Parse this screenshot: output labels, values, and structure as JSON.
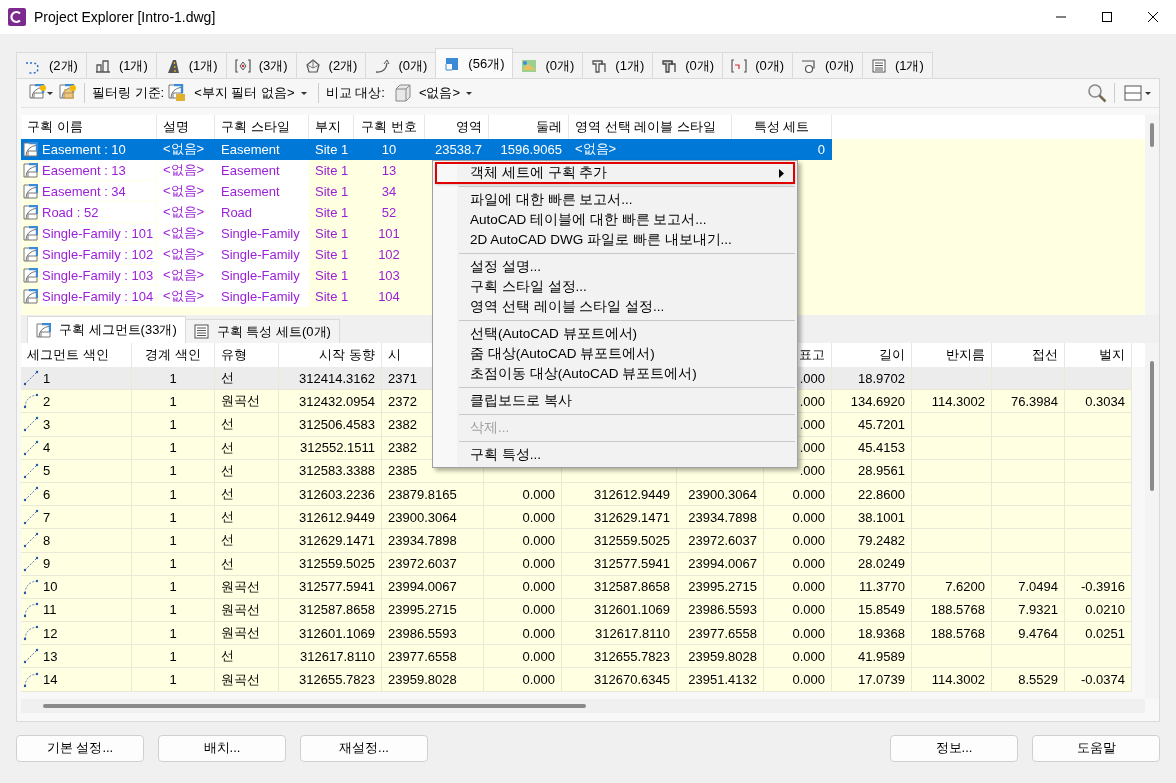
{
  "window": {
    "title": "Project Explorer [Intro-1.dwg]"
  },
  "tabs": [
    {
      "label": "(2개)",
      "selected": false
    },
    {
      "label": "(1개)",
      "selected": false
    },
    {
      "label": "(1개)",
      "selected": false
    },
    {
      "label": "(3개)",
      "selected": false
    },
    {
      "label": "(2개)",
      "selected": false
    },
    {
      "label": "(0개)",
      "selected": false
    },
    {
      "label": "(56개)",
      "selected": true
    },
    {
      "label": "(0개)",
      "selected": false
    },
    {
      "label": "(1개)",
      "selected": false
    },
    {
      "label": "(0개)",
      "selected": false
    },
    {
      "label": "(0개)",
      "selected": false
    },
    {
      "label": "(0개)",
      "selected": false
    },
    {
      "label": "(1개)",
      "selected": false
    }
  ],
  "toolbar": {
    "filter_label": "필터링 기준:",
    "filter_value": "<부지 필터 없음>",
    "compare_label": "비교 대상:",
    "compare_value": "<없음>"
  },
  "parcels": {
    "columns": [
      "구획 이름",
      "설명",
      "구획 스타일",
      "부지",
      "구획 번호",
      "영역",
      "둘레",
      "영역 선택 레이블 스타일",
      "특성 세트"
    ],
    "rows": [
      {
        "selected": true,
        "cells": [
          "Easement : 10",
          "<없음>",
          "Easement",
          "Site 1",
          "10",
          "23538.7",
          "1596.9065",
          "<없음>",
          "0"
        ]
      },
      {
        "selected": false,
        "cells": [
          "Easement : 13",
          "<없음>",
          "Easement",
          "Site 1",
          "13",
          null,
          null,
          null,
          null
        ]
      },
      {
        "selected": false,
        "cells": [
          "Easement : 34",
          "<없음>",
          "Easement",
          "Site 1",
          "34",
          null,
          null,
          null,
          null
        ]
      },
      {
        "selected": false,
        "cells": [
          "Road : 52",
          "<없음>",
          "Road",
          "Site 1",
          "52",
          null,
          null,
          null,
          null
        ]
      },
      {
        "selected": false,
        "cells": [
          "Single-Family : 101",
          "<없음>",
          "Single-Family",
          "Site 1",
          "101",
          null,
          null,
          null,
          null
        ]
      },
      {
        "selected": false,
        "cells": [
          "Single-Family : 102",
          "<없음>",
          "Single-Family",
          "Site 1",
          "102",
          null,
          null,
          null,
          null
        ]
      },
      {
        "selected": false,
        "cells": [
          "Single-Family : 103",
          "<없음>",
          "Single-Family",
          "Site 1",
          "103",
          null,
          null,
          null,
          null
        ]
      },
      {
        "selected": false,
        "cells": [
          "Single-Family : 104",
          "<없음>",
          "Single-Family",
          "Site 1",
          "104",
          null,
          null,
          null,
          null
        ]
      }
    ]
  },
  "sub_tabs": [
    {
      "label": "구획 세그먼트(33개)",
      "selected": true
    },
    {
      "label": "구획 특성 세트(0개)",
      "selected": false
    }
  ],
  "segments": {
    "columns": [
      "세그먼트 색인",
      "경계 색인",
      "유형",
      "시작 동향",
      "시",
      null,
      null,
      null,
      "표고",
      "길이",
      "반지름",
      "접선",
      "벌지"
    ],
    "rows": [
      {
        "kind": "line",
        "selected": true,
        "cells": [
          "1",
          "1",
          "선",
          "312414.3162",
          "2371",
          null,
          null,
          null,
          ".000",
          "18.9702",
          null,
          null,
          null
        ]
      },
      {
        "kind": "arc",
        "selected": false,
        "cells": [
          "2",
          "1",
          "원곡선",
          "312432.0954",
          "2372",
          null,
          null,
          null,
          ".000",
          "134.6920",
          "114.3002",
          "76.3984",
          "0.3034"
        ]
      },
      {
        "kind": "line",
        "selected": false,
        "cells": [
          "3",
          "1",
          "선",
          "312506.4583",
          "2382",
          null,
          null,
          null,
          ".000",
          "45.7201",
          null,
          null,
          null
        ]
      },
      {
        "kind": "line",
        "selected": false,
        "cells": [
          "4",
          "1",
          "선",
          "312552.1511",
          "2382",
          null,
          null,
          null,
          ".000",
          "45.4153",
          null,
          null,
          null
        ]
      },
      {
        "kind": "line",
        "selected": false,
        "cells": [
          "5",
          "1",
          "선",
          "312583.3388",
          "2385",
          null,
          null,
          null,
          ".000",
          "28.9561",
          null,
          null,
          null
        ]
      },
      {
        "kind": "line",
        "selected": false,
        "cells": [
          "6",
          "1",
          "선",
          "312603.2236",
          "23879.8165",
          "0.000",
          "312612.9449",
          "23900.3064",
          "0.000",
          "22.8600",
          null,
          null,
          null
        ]
      },
      {
        "kind": "line",
        "selected": false,
        "cells": [
          "7",
          "1",
          "선",
          "312612.9449",
          "23900.3064",
          "0.000",
          "312629.1471",
          "23934.7898",
          "0.000",
          "38.1001",
          null,
          null,
          null
        ]
      },
      {
        "kind": "line",
        "selected": false,
        "cells": [
          "8",
          "1",
          "선",
          "312629.1471",
          "23934.7898",
          "0.000",
          "312559.5025",
          "23972.6037",
          "0.000",
          "79.2482",
          null,
          null,
          null
        ]
      },
      {
        "kind": "line",
        "selected": false,
        "cells": [
          "9",
          "1",
          "선",
          "312559.5025",
          "23972.6037",
          "0.000",
          "312577.5941",
          "23994.0067",
          "0.000",
          "28.0249",
          null,
          null,
          null
        ]
      },
      {
        "kind": "arc",
        "selected": false,
        "cells": [
          "10",
          "1",
          "원곡선",
          "312577.5941",
          "23994.0067",
          "0.000",
          "312587.8658",
          "23995.2715",
          "0.000",
          "11.3770",
          "7.6200",
          "7.0494",
          "-0.3916"
        ]
      },
      {
        "kind": "arc",
        "selected": false,
        "cells": [
          "11",
          "1",
          "원곡선",
          "312587.8658",
          "23995.2715",
          "0.000",
          "312601.1069",
          "23986.5593",
          "0.000",
          "15.8549",
          "188.5768",
          "7.9321",
          "0.0210"
        ]
      },
      {
        "kind": "arc",
        "selected": false,
        "cells": [
          "12",
          "1",
          "원곡선",
          "312601.1069",
          "23986.5593",
          "0.000",
          "312617.8110",
          "23977.6558",
          "0.000",
          "18.9368",
          "188.5768",
          "9.4764",
          "0.0251"
        ]
      },
      {
        "kind": "line",
        "selected": false,
        "cells": [
          "13",
          "1",
          "선",
          "312617.8110",
          "23977.6558",
          "0.000",
          "312655.7823",
          "23959.8028",
          "0.000",
          "41.9589",
          null,
          null,
          null
        ]
      },
      {
        "kind": "arc",
        "selected": false,
        "cells": [
          "14",
          "1",
          "원곡선",
          "312655.7823",
          "23959.8028",
          "0.000",
          "312670.6345",
          "23951.4132",
          "0.000",
          "17.0739",
          "114.3002",
          "8.5529",
          "-0.0374"
        ]
      }
    ]
  },
  "context_menu": {
    "items": [
      {
        "kind": "submenu",
        "label": "객체 세트에 구획 추가",
        "highlighted": true,
        "disabled": false
      },
      {
        "kind": "separator"
      },
      {
        "kind": "item",
        "label": "파일에 대한 빠른 보고서...",
        "highlighted": false,
        "disabled": false
      },
      {
        "kind": "item",
        "label": "AutoCAD 테이블에 대한 빠른 보고서...",
        "highlighted": false,
        "disabled": false
      },
      {
        "kind": "item",
        "label": "2D AutoCAD DWG 파일로 빠른 내보내기...",
        "highlighted": false,
        "disabled": false
      },
      {
        "kind": "separator"
      },
      {
        "kind": "item",
        "label": "설정 설명...",
        "highlighted": false,
        "disabled": false
      },
      {
        "kind": "item",
        "label": "구획 스타일 설정...",
        "highlighted": false,
        "disabled": false
      },
      {
        "kind": "item",
        "label": "영역 선택 레이블 스타일 설정...",
        "highlighted": false,
        "disabled": false
      },
      {
        "kind": "separator"
      },
      {
        "kind": "item",
        "label": "선택(AutoCAD 뷰포트에서)",
        "highlighted": false,
        "disabled": false
      },
      {
        "kind": "item",
        "label": "줌 대상(AutoCAD 뷰포트에서)",
        "highlighted": false,
        "disabled": false
      },
      {
        "kind": "item",
        "label": "초점이동 대상(AutoCAD 뷰포트에서)",
        "highlighted": false,
        "disabled": false
      },
      {
        "kind": "separator"
      },
      {
        "kind": "item",
        "label": "클립보드로 복사",
        "highlighted": false,
        "disabled": false
      },
      {
        "kind": "separator"
      },
      {
        "kind": "item",
        "label": "삭제...",
        "highlighted": false,
        "disabled": true
      },
      {
        "kind": "separator"
      },
      {
        "kind": "item",
        "label": "구획 특성...",
        "highlighted": false,
        "disabled": false
      }
    ]
  },
  "buttons_left": [
    "기본 설정...",
    "배치...",
    "재설정..."
  ],
  "buttons_right": [
    "정보...",
    "도움말"
  ]
}
